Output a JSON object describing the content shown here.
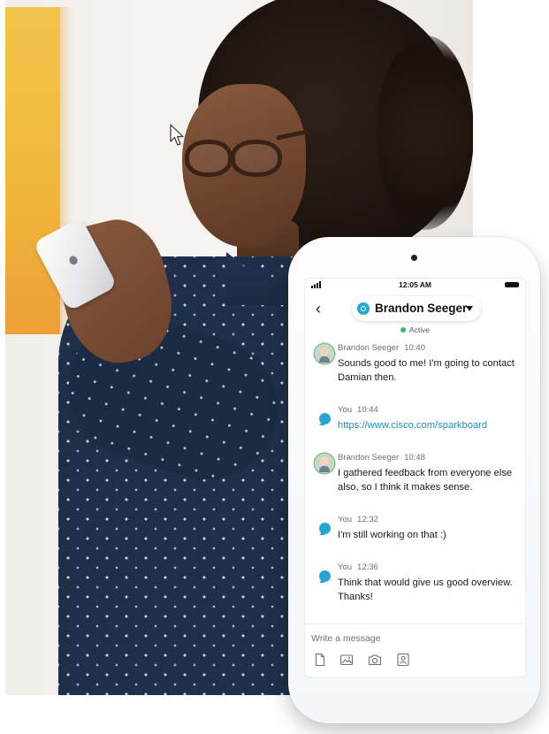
{
  "status_bar": {
    "time": "12:05 AM"
  },
  "conversation": {
    "contact_name": "Brandon Seeger",
    "status": "Active"
  },
  "messages": [
    {
      "sender": "Brandon Seeger",
      "time": "10:40",
      "text": "Sounds good to me! I'm going to contact Damian then.",
      "kind": "contact"
    },
    {
      "sender": "You",
      "time": "10:44",
      "text": "https://www.cisco.com/sparkboard",
      "kind": "self-link"
    },
    {
      "sender": "Brandon Seeger",
      "time": "10:48",
      "text": "I gathered feedback from everyone else also, so I think it makes sense.",
      "kind": "contact"
    },
    {
      "sender": "You",
      "time": "12:32",
      "text": "I'm still working on that :)",
      "kind": "self"
    },
    {
      "sender": "You",
      "time": "12:36",
      "text": "Think that would give us good overview. Thanks!",
      "kind": "self"
    }
  ],
  "composer": {
    "placeholder": "Write a message"
  },
  "toolbar_icons": [
    "file-icon",
    "image-icon",
    "camera-icon",
    "contact-card-icon"
  ],
  "colors": {
    "accent": "#24a5d4",
    "link": "#1f8ec4",
    "presence_active": "#3dbb61"
  }
}
